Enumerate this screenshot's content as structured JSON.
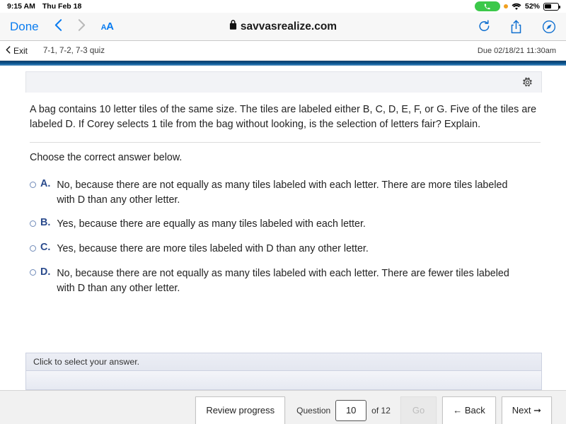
{
  "status_bar": {
    "time": "9:15 AM",
    "date": "Thu Feb 18",
    "battery_percent": "52%",
    "call_icon": "phone-call-icon",
    "recording_dot": "orange-recording-dot",
    "wifi_icon": "wifi-icon",
    "battery_icon": "battery-icon"
  },
  "safari": {
    "done_label": "Done",
    "back_icon": "chevron-left-icon",
    "forward_icon": "chevron-right-icon",
    "text_size_label": "AA",
    "lock_icon": "lock-icon",
    "url": "savvasrealize.com",
    "reload_icon": "reload-icon",
    "share_icon": "share-icon",
    "tabs_icon": "compass-icon"
  },
  "assignment_bar": {
    "exit_icon": "chevron-left-icon",
    "exit_label": "Exit",
    "title": "7-1, 7-2, 7-3 quiz",
    "due": "Due 02/18/21 11:30am"
  },
  "card": {
    "settings_icon": "gear-icon"
  },
  "question": {
    "text": "A bag contains 10 letter tiles of the same size. The tiles are labeled either B, C, D, E, F, or G. Five of the tiles are labeled D. If Corey selects 1 tile from the bag without looking, is the selection of letters fair? Explain.",
    "prompt": "Choose the correct answer below.",
    "options": [
      {
        "letter": "A.",
        "text": "No, because there are not equally as many tiles labeled with each letter. There are more tiles labeled with D than any other letter."
      },
      {
        "letter": "B.",
        "text": "Yes, because there are equally as many tiles labeled with each letter."
      },
      {
        "letter": "C.",
        "text": "Yes, because there are more tiles labeled with D than any other letter."
      },
      {
        "letter": "D.",
        "text": "No, because there are not equally as many tiles labeled with each letter. There are fewer tiles labeled with D than any other letter."
      }
    ]
  },
  "answer_area": {
    "hint": "Click to select your answer."
  },
  "footer": {
    "review_progress_label": "Review progress",
    "question_label": "Question",
    "question_number": "10",
    "of_label": "of 12",
    "go_label": "Go",
    "back_label": "Back",
    "back_icon": "arrow-left-icon",
    "next_label": "Next",
    "next_icon": "arrow-right-icon"
  },
  "colors": {
    "ios_blue": "#0a7cf0",
    "brand_blue": "#0c4f86",
    "option_letter_blue": "#2a4a8c",
    "call_green": "#3cc84a"
  }
}
